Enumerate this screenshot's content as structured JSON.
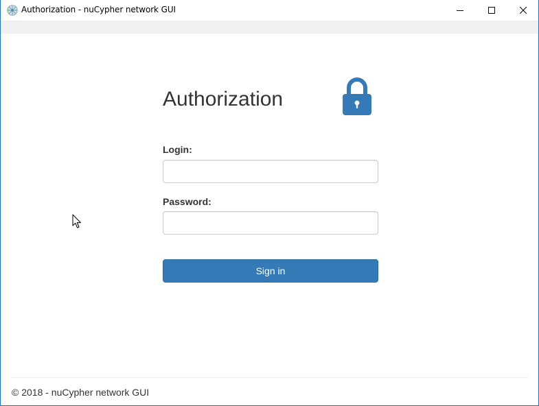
{
  "window": {
    "title": "Authorization - nuCypher network GUI",
    "icon": "nucypher-app-icon",
    "controls": [
      "minimize",
      "maximize",
      "close"
    ]
  },
  "form": {
    "heading": "Authorization",
    "icon": "lock-icon",
    "login_label": "Login:",
    "login_value": "",
    "password_label": "Password:",
    "password_value": "",
    "submit_label": "Sign in"
  },
  "footer": {
    "text": "© 2018 - nuCypher network GUI"
  },
  "colors": {
    "accent": "#337ab7",
    "text": "#333333",
    "window_border": "#1a73c8"
  }
}
